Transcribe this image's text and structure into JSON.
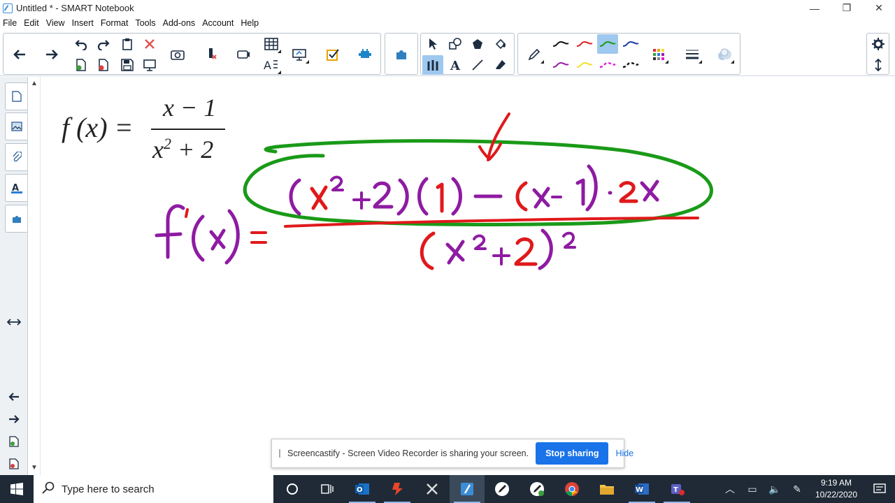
{
  "window": {
    "title": "Untitled * - SMART Notebook",
    "minimize_glyph": "—",
    "restore_glyph": "❐",
    "close_glyph": "✕"
  },
  "menu": [
    "File",
    "Edit",
    "View",
    "Insert",
    "Format",
    "Tools",
    "Add-ons",
    "Account",
    "Help"
  ],
  "canvas": {
    "formula": {
      "lhs": "f (x) =",
      "numerator": "x − 1",
      "denominator_base": "x",
      "denominator_exp": "2",
      "denominator_rest": " + 2"
    },
    "ink_colors": {
      "purple": "#8e1ba2",
      "red": "#e0191b",
      "green": "#1a9a18"
    }
  },
  "screen_share": {
    "message": "Screencastify - Screen Video Recorder is sharing your screen.",
    "stop_label": "Stop sharing",
    "hide_label": "Hide"
  },
  "taskbar": {
    "search_placeholder": "Type here to search",
    "time": "9:19 AM",
    "date": "10/22/2020"
  }
}
